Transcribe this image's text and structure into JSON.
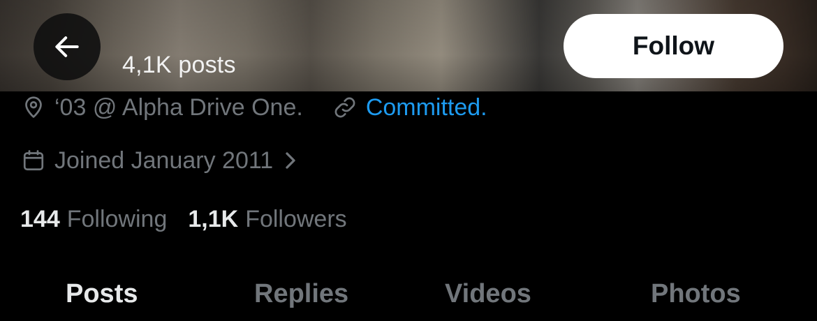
{
  "header": {
    "posts_count": "4,1K posts",
    "follow_label": "Follow",
    "back_icon": "arrow-left-icon"
  },
  "profile": {
    "location": "‘03 @ Alpha Drive One.",
    "location_icon": "location-pin-icon",
    "link": "Committed.",
    "link_icon": "link-icon",
    "joined": "Joined January 2011",
    "joined_icon": "calendar-icon"
  },
  "stats": {
    "following_count": "144",
    "following_label": "Following",
    "followers_count": "1,1K",
    "followers_label": "Followers"
  },
  "tabs": [
    {
      "label": "Posts",
      "active": true
    },
    {
      "label": "Replies",
      "active": false
    },
    {
      "label": "Videos",
      "active": false
    },
    {
      "label": "Photos",
      "active": false
    }
  ],
  "colors": {
    "background": "#000000",
    "primary_text": "#e7e9ea",
    "secondary_text": "#71767b",
    "link": "#1d9bf0",
    "follow_button_bg": "#ffffff"
  }
}
